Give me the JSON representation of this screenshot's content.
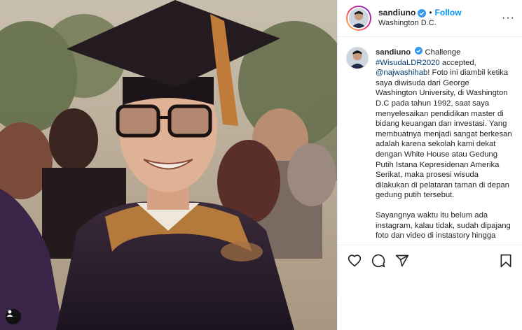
{
  "post": {
    "username": "sandiuno",
    "location": "Washington D.C.",
    "follow_label": "Follow",
    "separator": "•",
    "more_label": "···"
  },
  "caption": {
    "username": "sandiuno",
    "intro": "Challenge",
    "hashtag": "#WisudaLDR2020",
    "after_hashtag": " accepted,",
    "mention": "@najwashihab",
    "body1": "! Foto ini diambil ketika saya diwisuda dari George Washington University, di Washington D.C pada tahun 1992, saat saya menyelesaikan pendidikan master di bidang keuangan dan investasi. Yang membuatnya menjadi sangat berkesan adalah karena sekolah kami dekat dengan White House atau Gedung Putih Istana Kepresidenan Amerika Serikat, maka prosesi wisuda dilakukan di pelataran taman di depan gedung putih tersebut.",
    "body2": "Sayangnya waktu itu belum ada instagram, kalau tidak, sudah dipajang foto dan video di instastory hingga"
  },
  "icons": {
    "verified": "verified-badge-icon",
    "like": "heart-icon",
    "comment": "comment-icon",
    "share": "paper-plane-icon",
    "save": "bookmark-icon",
    "tags": "user-tag-icon"
  },
  "colors": {
    "accent": "#0095f6",
    "link": "#00376b",
    "text": "#262626",
    "border": "#efefef"
  }
}
